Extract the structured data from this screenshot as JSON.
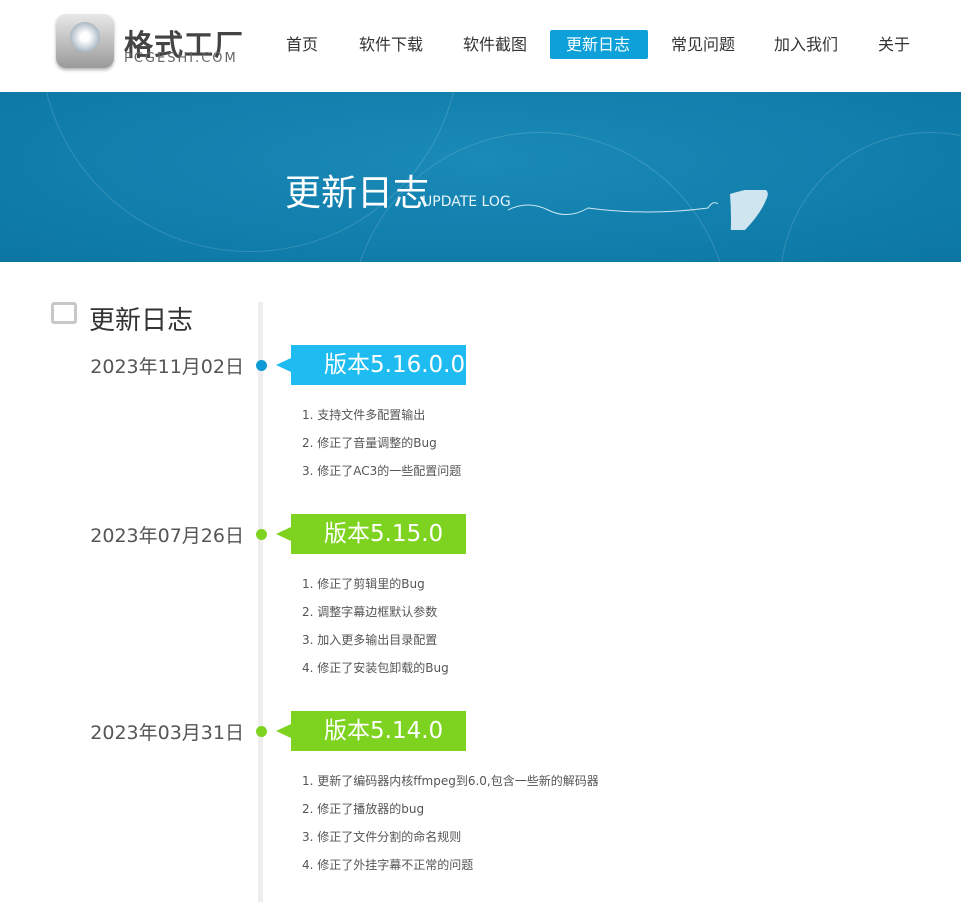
{
  "header": {
    "logo_cn": "格式工厂",
    "logo_en": "PCGESHI.COM",
    "nav": [
      {
        "label": "首页"
      },
      {
        "label": "软件下载"
      },
      {
        "label": "软件截图"
      },
      {
        "label": "更新日志",
        "active": true
      },
      {
        "label": "常见问题"
      },
      {
        "label": "加入我们"
      },
      {
        "label": "关于"
      }
    ]
  },
  "banner": {
    "title": "更新日志",
    "subtitle": "UPDATE LOG"
  },
  "section": {
    "title": "更新日志"
  },
  "entries": [
    {
      "date": "2023年11月02日",
      "version": "版本5.16.0.0",
      "color": "#1ebcf0",
      "dot": "#0f9ad6",
      "items": [
        "1. 支持文件多配置输出",
        "2. 修正了音量调整的Bug",
        "3. 修正了AC3的一些配置问题"
      ]
    },
    {
      "date": "2023年07月26日",
      "version": "版本5.15.0",
      "color": "#7ed321",
      "dot": "#7ed321",
      "items": [
        "1. 修正了剪辑里的Bug",
        "2. 调整字幕边框默认参数",
        "3. 加入更多输出目录配置",
        "4. 修正了安装包卸载的Bug"
      ]
    },
    {
      "date": "2023年03月31日",
      "version": "版本5.14.0",
      "color": "#7ed321",
      "dot": "#7ed321",
      "items": [
        "1. 更新了编码器内核ffmpeg到6.0,包含一些新的解码器",
        "2. 修正了播放器的bug",
        "3. 修正了文件分割的命名规则",
        "4. 修正了外挂字幕不正常的问题"
      ]
    }
  ]
}
